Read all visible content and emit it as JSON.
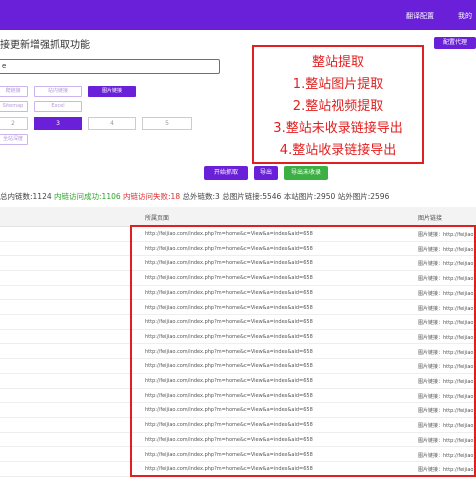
{
  "header": {
    "links": [
      "翻译配置",
      "我的"
    ]
  },
  "headline": "接更新增强抓取功能",
  "config_button": "配置代理",
  "url_input": {
    "value": "e"
  },
  "options_row1": [
    "爬链接",
    "站内链接",
    "图片链接"
  ],
  "options_row2": [
    "Sitemap",
    "Excel"
  ],
  "numbers": [
    "2",
    "3",
    "4",
    "5"
  ],
  "options_row4": [
    "全站深度"
  ],
  "actions": {
    "start": "开始抓取",
    "export": "导出",
    "export_unrecorded": "导出未收录"
  },
  "stats": {
    "total_links": "总内链数:1124",
    "success": "内链访问成功:1106",
    "failed": "内链访问失败:18",
    "external": "总外链数:3",
    "total_images": "总图片链接:5546",
    "site_images": "本站图片:2950",
    "external_images": "站外图片:2596"
  },
  "table": {
    "headers": [
      "所属页面",
      "图片链接"
    ],
    "rows": [
      {
        "page": "http://feijiao.com/index.php?m=home&c=View&a=index&aid=658",
        "img": "图片链接：http://feijiao"
      },
      {
        "page": "http://feijiao.com/index.php?m=home&c=View&a=index&aid=658",
        "img": "图片链接：http://feijiao"
      },
      {
        "page": "http://feijiao.com/index.php?m=home&c=View&a=index&aid=658",
        "img": "图片链接：http://feijiao"
      },
      {
        "page": "http://feijiao.com/index.php?m=home&c=View&a=index&aid=658",
        "img": "图片链接：http://feijiao"
      },
      {
        "page": "http://feijiao.com/index.php?m=home&c=View&a=index&aid=658",
        "img": "图片链接：http://feijiao"
      },
      {
        "page": "http://feijiao.com/index.php?m=home&c=View&a=index&aid=658",
        "img": "图片链接：http://feijiao"
      },
      {
        "page": "http://feijiao.com/index.php?m=home&c=View&a=index&aid=658",
        "img": "图片链接：http://feijiao"
      },
      {
        "page": "http://feijiao.com/index.php?m=home&c=View&a=index&aid=658",
        "img": "图片链接：http://feijiao"
      },
      {
        "page": "http://feijiao.com/index.php?m=home&c=View&a=index&aid=658",
        "img": "图片链接：http://feijiao"
      },
      {
        "page": "http://feijiao.com/index.php?m=home&c=View&a=index&aid=658",
        "img": "图片链接：http://feijiao"
      },
      {
        "page": "http://feijiao.com/index.php?m=home&c=View&a=index&aid=658",
        "img": "图片链接：http://feijiao"
      },
      {
        "page": "http://feijiao.com/index.php?m=home&c=View&a=index&aid=658",
        "img": "图片链接：http://feijiao"
      },
      {
        "page": "http://feijiao.com/index.php?m=home&c=View&a=index&aid=658",
        "img": "图片链接：http://feijiao"
      },
      {
        "page": "http://feijiao.com/index.php?m=home&c=View&a=index&aid=658",
        "img": "图片链接：http://feijiao"
      },
      {
        "page": "http://feijiao.com/index.php?m=home&c=View&a=index&aid=658",
        "img": "图片链接：http://feijiao"
      },
      {
        "page": "http://feijiao.com/index.php?m=home&c=View&a=index&aid=658",
        "img": "图片链接：http://feijiao"
      },
      {
        "page": "http://feijiao.com/index.php?m=home&c=View&a=index&aid=658",
        "img": "图片链接：http://feijiao"
      }
    ]
  },
  "callout": {
    "lines": [
      "整站提取",
      "1.整站图片提取",
      "2.整站视频提取",
      "3.整站未收录链接导出",
      "4.整站收录链接导出"
    ]
  },
  "colors": {
    "brand": "#6a1fd8",
    "annotation": "#e02020",
    "success": "#2aa52a",
    "export_unrecorded": "#3cb043"
  }
}
